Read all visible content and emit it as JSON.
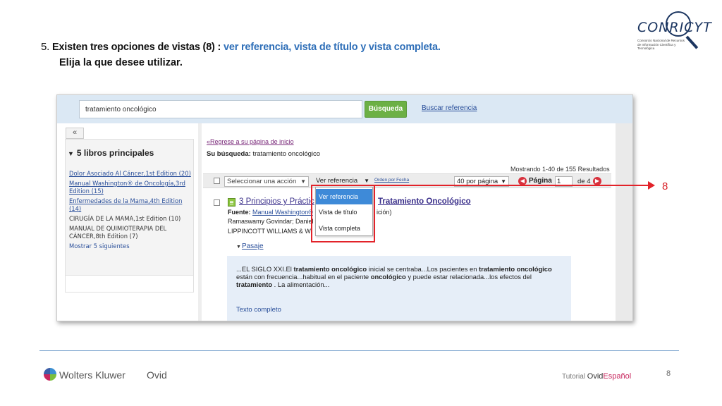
{
  "heading": {
    "number": "5.",
    "text_before": " Existen tres opciones de vistas (8) : ",
    "highlight": "ver referencia, vista de título y vista completa.",
    "line2": "Elija la que desee utilizar.",
    "highlight_color": "#2f6fb8"
  },
  "logo": {
    "word": "CONRICYT",
    "subtitle": "Consorcio Nacional de Recursos de Información Científica y Tecnológica"
  },
  "search": {
    "value": "tratamiento oncológico",
    "button_label": "Búsqueda",
    "link_label": "Buscar referencia"
  },
  "sidebar": {
    "collapse_label": "«",
    "title": "5 libros principales",
    "items": [
      {
        "label": "Dolor Asociado Al Cáncer,1st Edition (20)",
        "style": "link"
      },
      {
        "label": "Manual Washington® de Oncología,3rd Edition (15)",
        "style": "link"
      },
      {
        "label": "Enfermedades de la Mama,4th Edition (14)",
        "style": "link"
      },
      {
        "label": "CIRUGÍA DE LA MAMA,1st Edition (10)",
        "style": "plain"
      },
      {
        "label": "MANUAL DE QUIMIOTERAPIA DEL CÁNCER,8th Edition (7)",
        "style": "plain"
      },
      {
        "label": "Mostrar 5 siguientes",
        "style": "more"
      }
    ]
  },
  "results": {
    "back_link": "«Regrese a su página de inicio",
    "your_search_label": "Su búsqueda:",
    "your_search_value": " tratamiento oncológico",
    "count": "Mostrando 1-40 de 155 Resultados"
  },
  "toolbar": {
    "select_action": "Seleccionar una acción",
    "view_select": "Ver referencia",
    "order_link": "Orden por Fecha",
    "per_page": "40 por página",
    "page_label": "Página",
    "page_value": "1",
    "page_of": "de 4"
  },
  "result": {
    "title_part1": "3 Principios y Práctic",
    "title_part2": "Tratamiento Oncológico",
    "source_label": "Fuente:",
    "source_link": "Manual Washington®",
    "source_tail": "ición)",
    "authors": "Ramaswamy Govindar; Daniel",
    "publisher": "LIPPINCOTT WILLIAMS & W",
    "passage_label": "Pasaje",
    "excerpt_segments": [
      {
        "t": "...EL SIGLO XXI.El ",
        "b": false
      },
      {
        "t": "tratamiento oncológico",
        "b": true
      },
      {
        "t": " inicial se centraba...Los pacientes en ",
        "b": false
      },
      {
        "t": "tratamiento oncológico",
        "b": true
      },
      {
        "t": " están con frecuencia...habitual en el paciente ",
        "b": false
      },
      {
        "t": "oncológico",
        "b": true
      },
      {
        "t": " y puede estar relacionada...los efectos del ",
        "b": false
      },
      {
        "t": "tratamiento",
        "b": true
      },
      {
        "t": " . La alimentación...",
        "b": false
      }
    ],
    "full_text_link": "Texto completo"
  },
  "dropdown": {
    "options": [
      "Ver referencia",
      "Vista de título",
      "Vista completa"
    ],
    "selected_index": 0
  },
  "callout": {
    "number": "8",
    "color": "#e2232a"
  },
  "footer": {
    "brand": "Wolters Kluwer",
    "product": "Ovid",
    "tutorial_label": "Tutorial",
    "tutorial_ovid": "Ovid",
    "tutorial_lang": "Español",
    "page_number": "8"
  }
}
